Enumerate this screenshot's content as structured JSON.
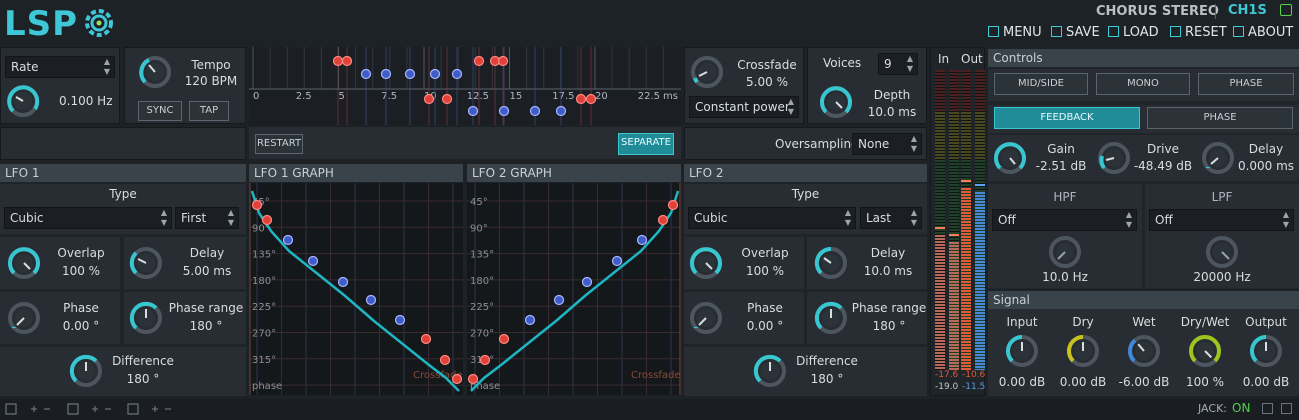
{
  "header": {
    "logo": "LSP",
    "plugin_name": "CHORUS STEREO",
    "plugin_code": "CH1S"
  },
  "topmenu": [
    {
      "label": "MENU",
      "icon": "menu-icon"
    },
    {
      "label": "SAVE",
      "icon": "save-icon"
    },
    {
      "label": "LOAD",
      "icon": "load-icon"
    },
    {
      "label": "RESET",
      "icon": "reset-icon"
    },
    {
      "label": "ABOUT",
      "icon": "about-icon"
    }
  ],
  "rate": {
    "mode": "Rate",
    "value": "0.100 Hz"
  },
  "tempo": {
    "label": "Tempo",
    "value": "120 BPM",
    "sync": "SYNC",
    "tap": "TAP"
  },
  "timeline": {
    "ticks": [
      "0",
      "2.5",
      "5",
      "7.5",
      "10",
      "12.5",
      "15",
      "17.5",
      "20",
      "22.5"
    ],
    "unit": "ms",
    "restart": "RESTART",
    "separate": "SEPARATE"
  },
  "crossfade": {
    "label": "Crossfade",
    "value": "5.00 %",
    "mode": "Constant power"
  },
  "voices": {
    "label": "Voices",
    "value": "9"
  },
  "depth": {
    "label": "Depth",
    "value": "10.0 ms"
  },
  "oversampling": {
    "label": "Oversampling",
    "value": "None"
  },
  "lfo1": {
    "title": "LFO 1",
    "type_label": "Type",
    "type": "Cubic",
    "mode": "First",
    "overlap_label": "Overlap",
    "overlap": "100 %",
    "delay_label": "Delay",
    "delay": "5.00 ms",
    "phase_label": "Phase",
    "phase": "0.00 °",
    "range_label": "Phase range",
    "range": "180 °",
    "diff_label": "Difference",
    "diff": "180 °"
  },
  "lfo2": {
    "title": "LFO 2",
    "type_label": "Type",
    "type": "Cubic",
    "mode": "Last",
    "overlap_label": "Overlap",
    "overlap": "100 %",
    "delay_label": "Delay",
    "delay": "10.0 ms",
    "phase_label": "Phase",
    "phase": "0.00 °",
    "range_label": "Phase range",
    "range": "180 °",
    "diff_label": "Difference",
    "diff": "180 °"
  },
  "graphs": {
    "g1_title": "LFO 1 GRAPH",
    "g2_title": "LFO 2 GRAPH",
    "angles": [
      "45°",
      "90°",
      "135°",
      "180°",
      "225°",
      "270°",
      "315°"
    ],
    "x_label": "Crossfade",
    "y_label": "phase"
  },
  "meters": {
    "in_label": "In",
    "out_label": "Out",
    "in_l": "-17.6",
    "in_r": "-19.0",
    "out_l": "-10.6",
    "out_r": "-11.5"
  },
  "controls": {
    "title": "Controls",
    "midside": "MID/SIDE",
    "mono": "MONO",
    "phase": "PHASE",
    "feedback": "FEEDBACK",
    "phase2": "PHASE",
    "gain_label": "Gain",
    "gain": "-2.51 dB",
    "drive_label": "Drive",
    "drive": "-48.49 dB",
    "fdelay_label": "Delay",
    "fdelay": "0.000 ms",
    "hpf_label": "HPF",
    "hpf_mode": "Off",
    "hpf_freq": "10.0 Hz",
    "lpf_label": "LPF",
    "lpf_mode": "Off",
    "lpf_freq": "20000 Hz"
  },
  "signal": {
    "title": "Signal",
    "input_label": "Input",
    "input": "0.00 dB",
    "dry_label": "Dry",
    "dry": "0.00 dB",
    "wet_label": "Wet",
    "wet": "-6.00 dB",
    "drywet_label": "Dry/Wet",
    "drywet": "100 %",
    "output_label": "Output",
    "output": "0.00 dB"
  },
  "status": {
    "jack_label": "JACK:",
    "jack_state": "ON"
  },
  "colors": {
    "accent": "#38c6d1",
    "red": "#e0413a",
    "blue": "#3f5cc8",
    "yellow": "#c8c21e",
    "green": "#9ec41e",
    "bg": "#1d2227"
  }
}
